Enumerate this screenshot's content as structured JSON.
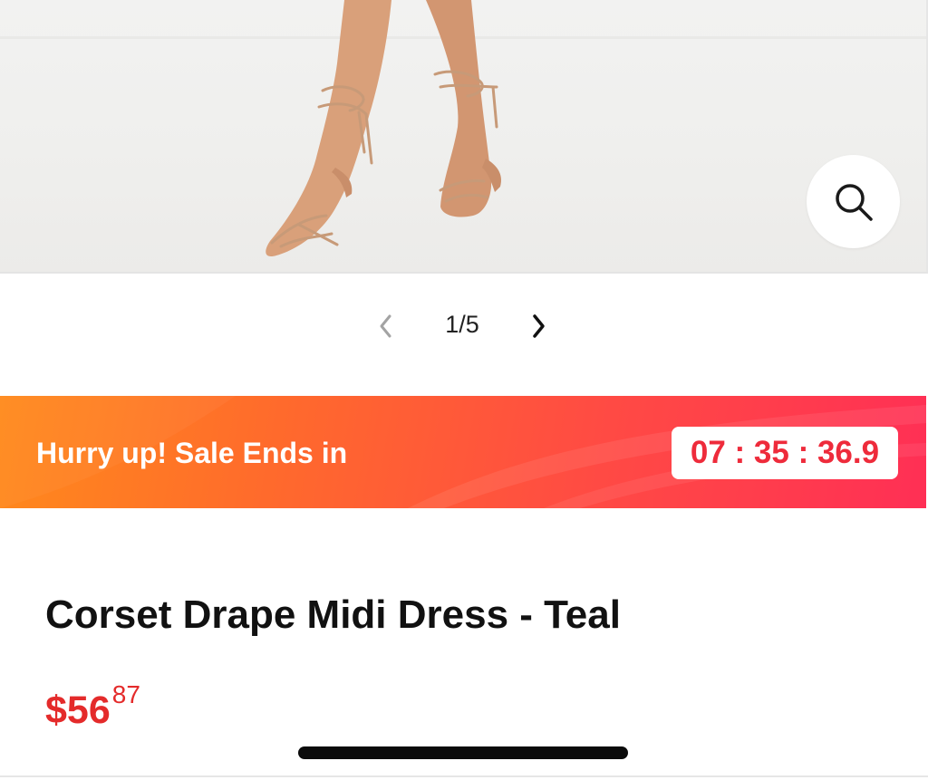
{
  "gallery": {
    "image_alt": "Model wearing strappy tie-up heeled sandals",
    "zoom_icon": "search-icon",
    "pager": {
      "current": "1/5",
      "prev_icon": "chevron-left-icon",
      "next_icon": "chevron-right-icon"
    }
  },
  "sale": {
    "label": "Hurry up! Sale Ends in",
    "countdown": "07 : 35 : 36.9",
    "colors": {
      "gradient_start": "#ff8a1c",
      "gradient_end": "#ff2f55",
      "countdown_text": "#ee2b3b"
    }
  },
  "product": {
    "title": "Corset Drape Midi Dress - Teal",
    "price_main": "$56",
    "price_cents": "87",
    "price_color": "#e42b2b"
  }
}
